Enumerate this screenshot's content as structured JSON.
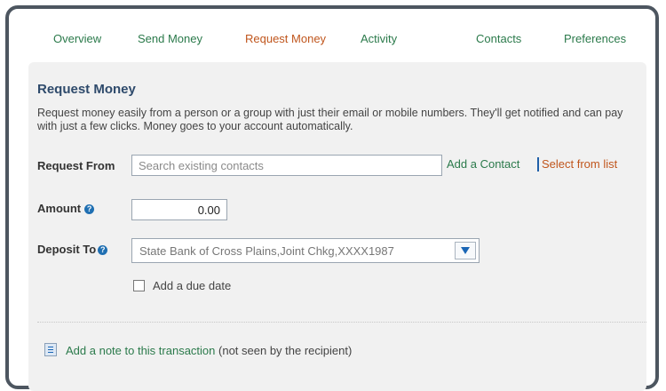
{
  "tabs": [
    {
      "label": "Overview",
      "active": false
    },
    {
      "label": "Send Money",
      "active": false
    },
    {
      "label": "Request Money",
      "active": true
    },
    {
      "label": "Activity",
      "active": false
    },
    {
      "label": "Contacts",
      "active": false
    },
    {
      "label": "Preferences",
      "active": false
    }
  ],
  "form": {
    "title": "Request Money",
    "description": "Request money easily from a person or a group with just their email or mobile numbers. They'll get notified and can pay with just a few clicks. Money goes to your account automatically.",
    "request_from": {
      "label": "Request From",
      "placeholder": "Search existing contacts",
      "add_contact_link": "Add a Contact",
      "select_list_link": "Select from list"
    },
    "amount": {
      "label": "Amount",
      "value": "0.00",
      "help_icon": "question-circle-icon"
    },
    "deposit_to": {
      "label": "Deposit To",
      "selected": "State Bank of Cross Plains,Joint Chkg,XXXX1987",
      "help_icon": "question-circle-icon"
    },
    "due_date": {
      "label": "Add a due date",
      "checked": false
    },
    "note": {
      "link": "Add a note to this transaction",
      "hint": "(not seen by the recipient)",
      "icon": "note-icon"
    }
  },
  "colors": {
    "tab_link": "#2b7a4b",
    "tab_active": "#c0561d",
    "title": "#2e4a6b",
    "help_icon": "#1f6fb2",
    "frame_border": "#4d5660",
    "panel_bg": "#f1f1f1"
  }
}
